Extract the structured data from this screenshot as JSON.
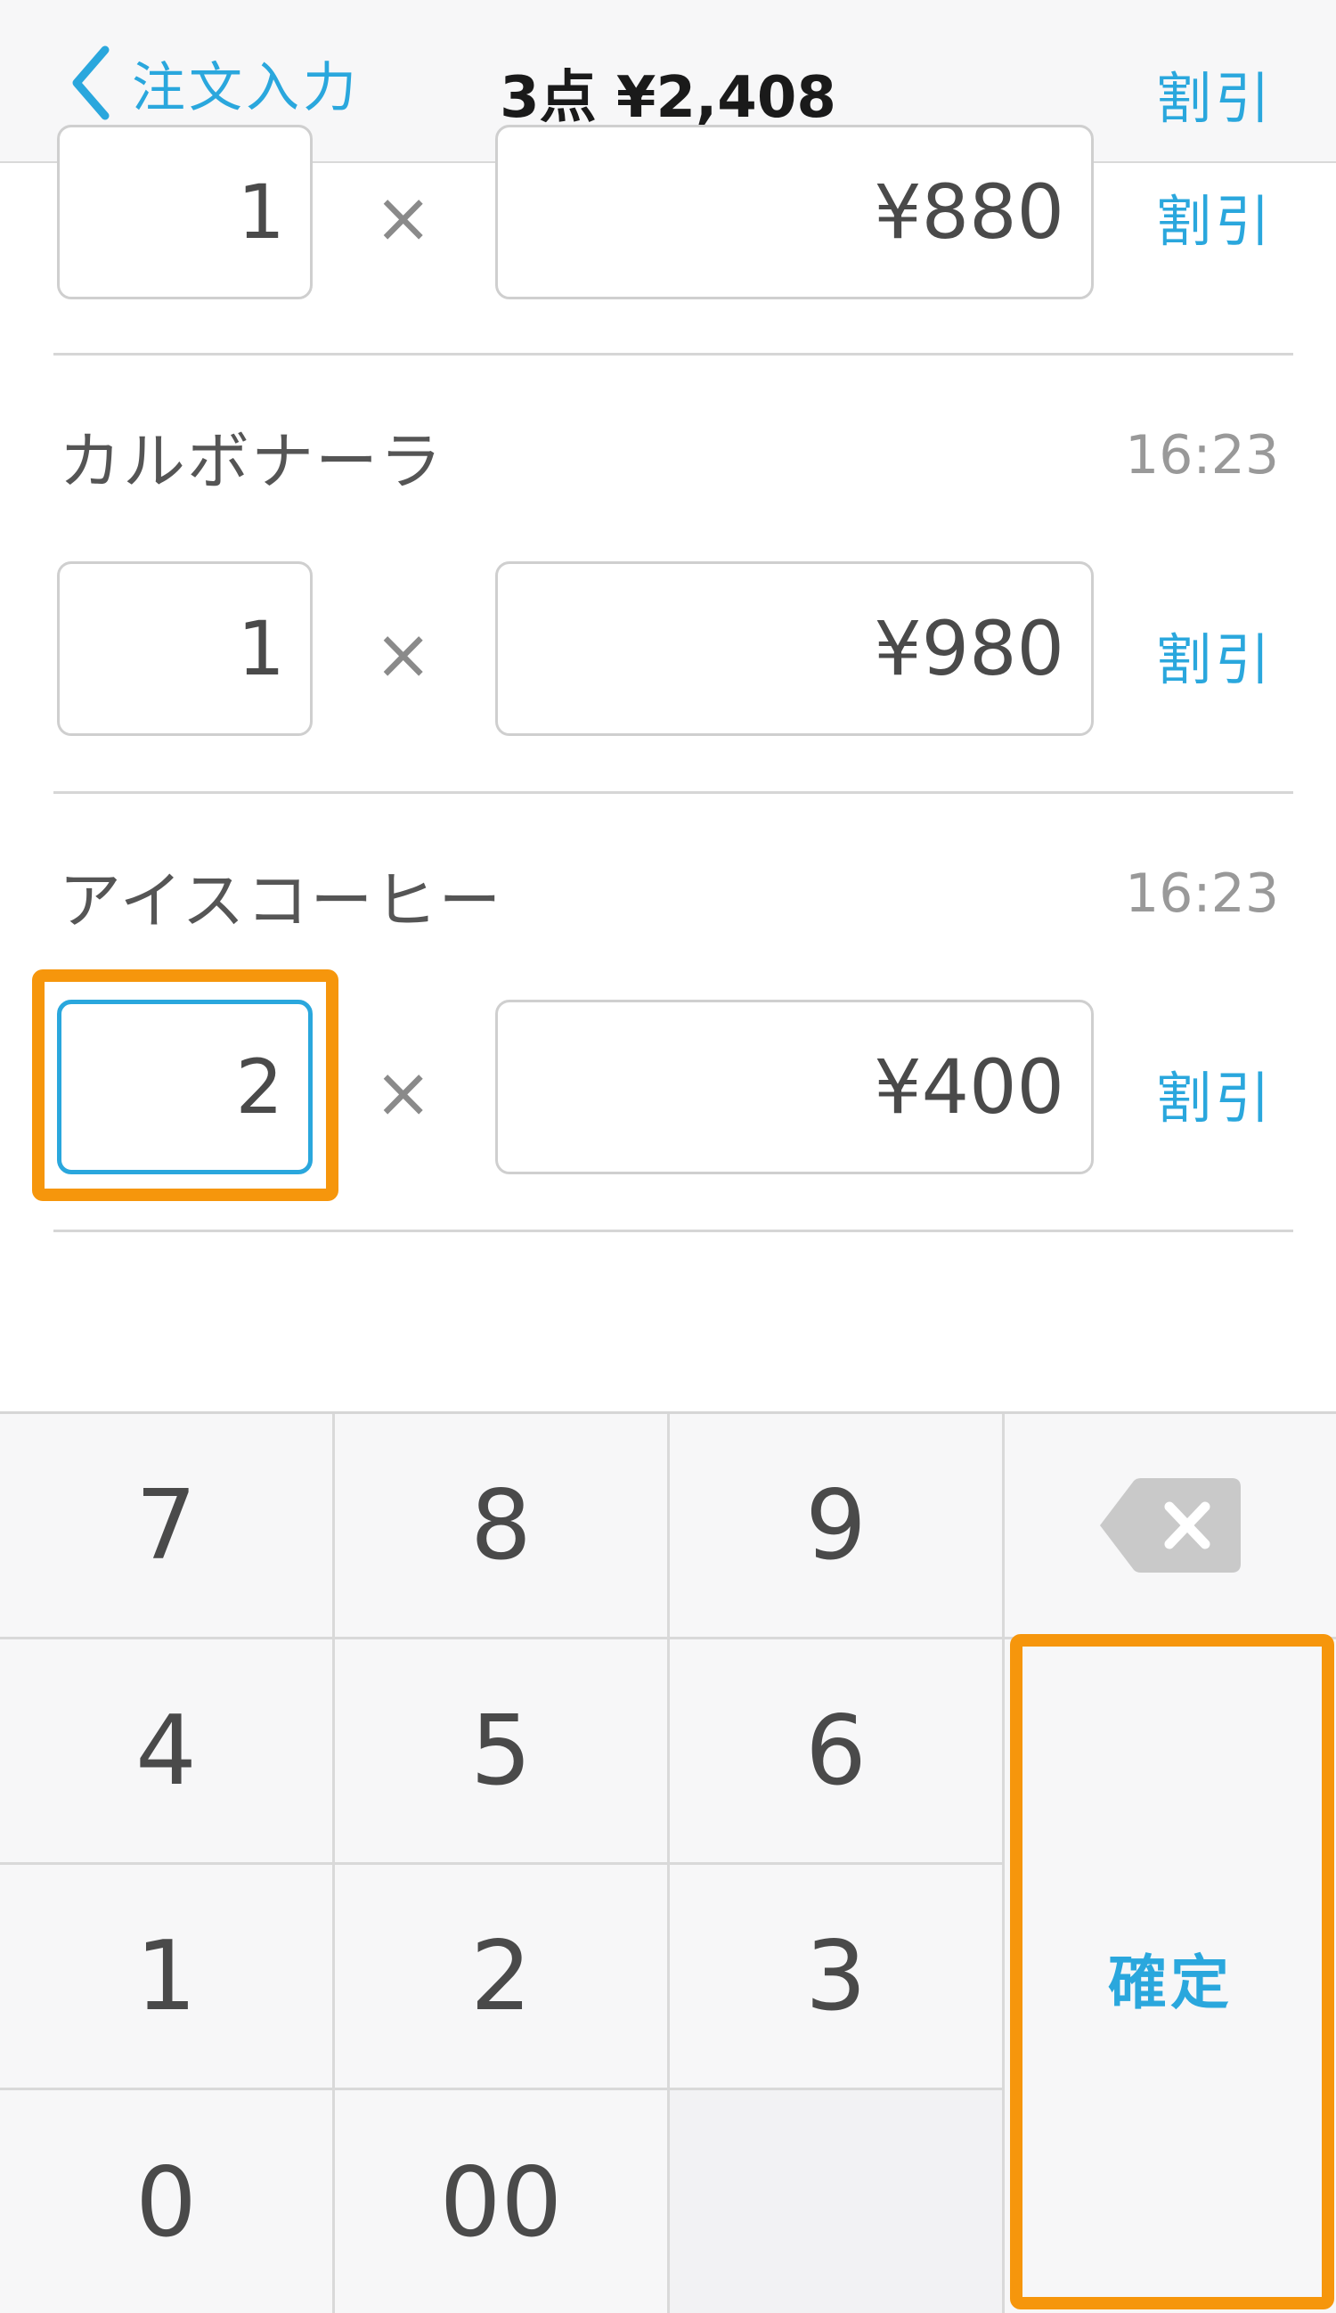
{
  "header": {
    "back_label": "注文入力",
    "title": "3点 ¥2,408",
    "discount_label": "割引"
  },
  "items": [
    {
      "name": "",
      "time": "",
      "quantity": "1",
      "price": "¥880",
      "discount_label": "割引"
    },
    {
      "name": "カルボナーラ",
      "time": "16:23",
      "quantity": "1",
      "price": "¥980",
      "discount_label": "割引"
    },
    {
      "name": "アイスコーヒー",
      "time": "16:23",
      "quantity": "2",
      "price": "¥400",
      "discount_label": "割引"
    }
  ],
  "times_symbol": "×",
  "keypad": {
    "keys": [
      "7",
      "8",
      "9",
      "4",
      "5",
      "6",
      "1",
      "2",
      "3",
      "0",
      "00"
    ],
    "backspace_icon": "backspace-icon",
    "confirm_label": "確定"
  },
  "colors": {
    "accent": "#2aa7dd",
    "highlight": "#f6960c",
    "text": "#4a4a4a"
  }
}
